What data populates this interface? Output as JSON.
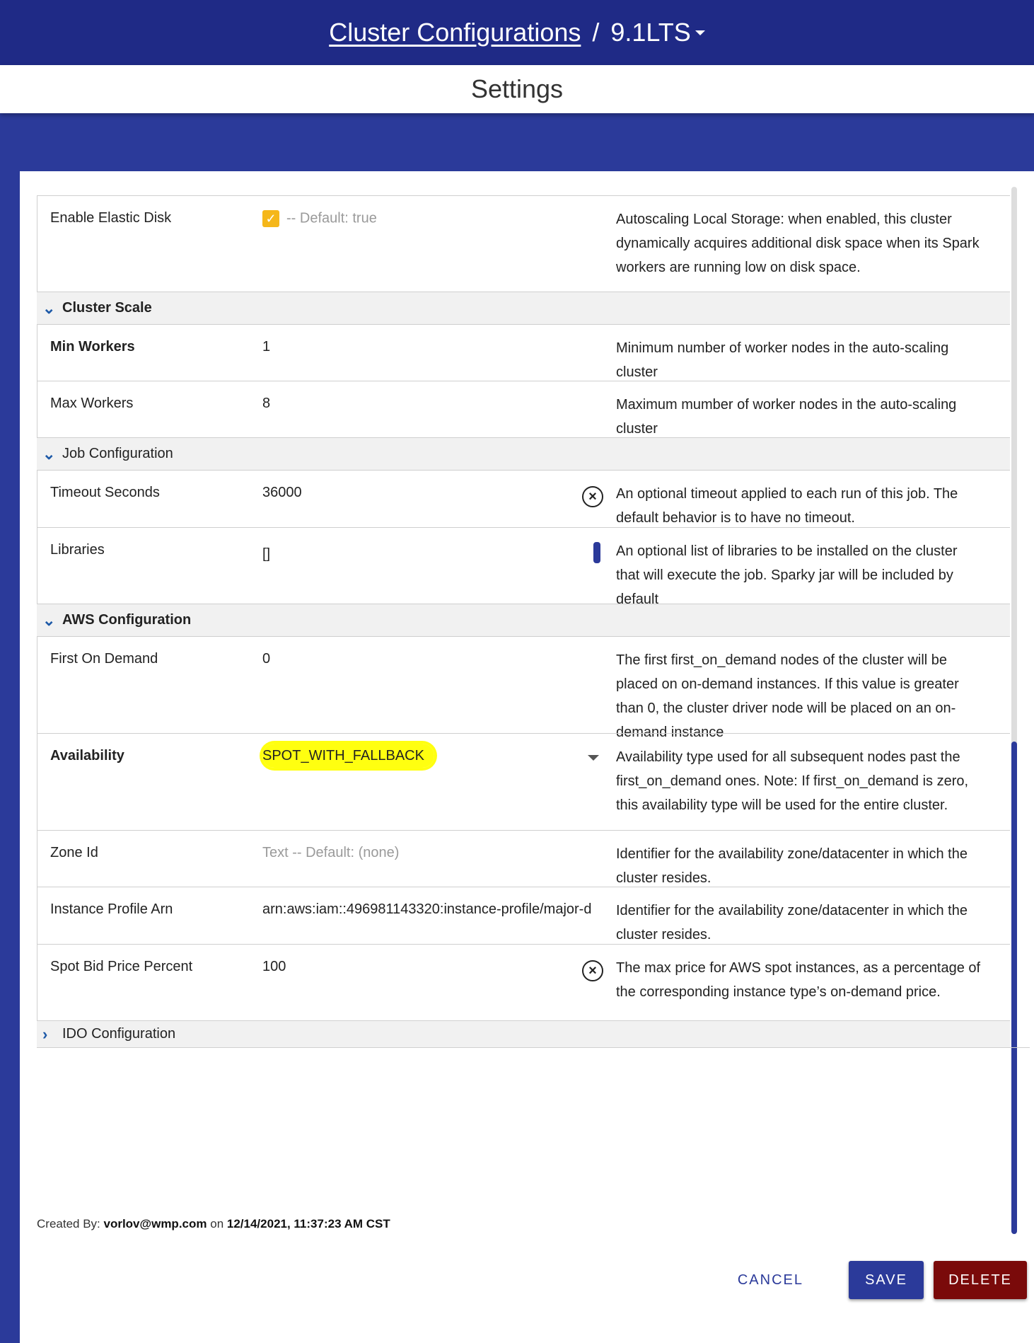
{
  "header": {
    "breadcrumb_link": "Cluster Configurations",
    "separator": "/",
    "version": "9.1LTS"
  },
  "subheader": {
    "title": "Settings"
  },
  "rows_top": [
    {
      "name": "Enable Elastic Disk",
      "value": "-- Default: true",
      "checked": true,
      "desc": "Autoscaling Local Storage: when enabled, this cluster dynamically acquires additional disk space when its Spark workers are running low on disk space."
    }
  ],
  "sections": {
    "cluster_scale": {
      "title": "Cluster Scale",
      "rows": [
        {
          "name": "Min Workers",
          "value": "1",
          "desc": "Minimum number of worker nodes in the auto-scaling cluster"
        },
        {
          "name": "Max Workers",
          "value": "8",
          "desc": "Maximum mumber of worker nodes in the auto-scaling cluster"
        }
      ]
    },
    "job_configuration": {
      "title": "Job Configuration",
      "rows": [
        {
          "name": "Timeout Seconds",
          "value": "36000",
          "desc": "An optional timeout applied to each run of this job. The default behavior is to have no timeout."
        },
        {
          "name": "Libraries",
          "value": "[]",
          "desc": "An optional list of libraries to be installed on the cluster that will execute the job. Sparky jar will be included by default"
        }
      ]
    },
    "aws_configuration": {
      "title": "AWS Configuration",
      "rows": [
        {
          "name": "First On Demand",
          "value": "0",
          "desc": "The first first_on_demand nodes of the cluster will be placed on on-demand instances. If this value is greater than 0, the cluster driver node will be placed on an on-demand instance"
        },
        {
          "name": "Availability",
          "value": "SPOT_WITH_FALLBACK",
          "desc": "Availability type used for all subsequent nodes past the first_on_demand ones. Note: If first_on_demand is zero, this availability type will be used for the entire cluster."
        },
        {
          "name": "Zone Id",
          "value": "Text -- Default: (none)",
          "desc": "Identifier for the availability zone/datacenter in which the cluster resides."
        },
        {
          "name": "Instance Profile Arn",
          "value": "arn:aws:iam::496981143320:instance-profile/major-d",
          "desc": "Identifier for the availability zone/datacenter in which the cluster resides."
        },
        {
          "name": "Spot Bid Price Percent",
          "value": "100",
          "desc": "The max price for AWS spot instances, as a percentage of the corresponding instance type’s on-demand price."
        }
      ]
    },
    "ido_configuration": {
      "title": "IDO Configuration"
    }
  },
  "footer": {
    "created_label": "Created By:",
    "created_by": "vorlov@wmp.com",
    "on_label": "on",
    "created_at": "12/14/2021, 11:37:23 AM CST"
  },
  "actions": {
    "cancel": "CANCEL",
    "save": "SAVE",
    "delete": "DELETE"
  },
  "colors": {
    "header_bg": "#1f2a86",
    "accent": "#2b3a9a",
    "delete": "#7a0a0a",
    "checkbox": "#f5b71a",
    "highlight": "#ffff10"
  }
}
